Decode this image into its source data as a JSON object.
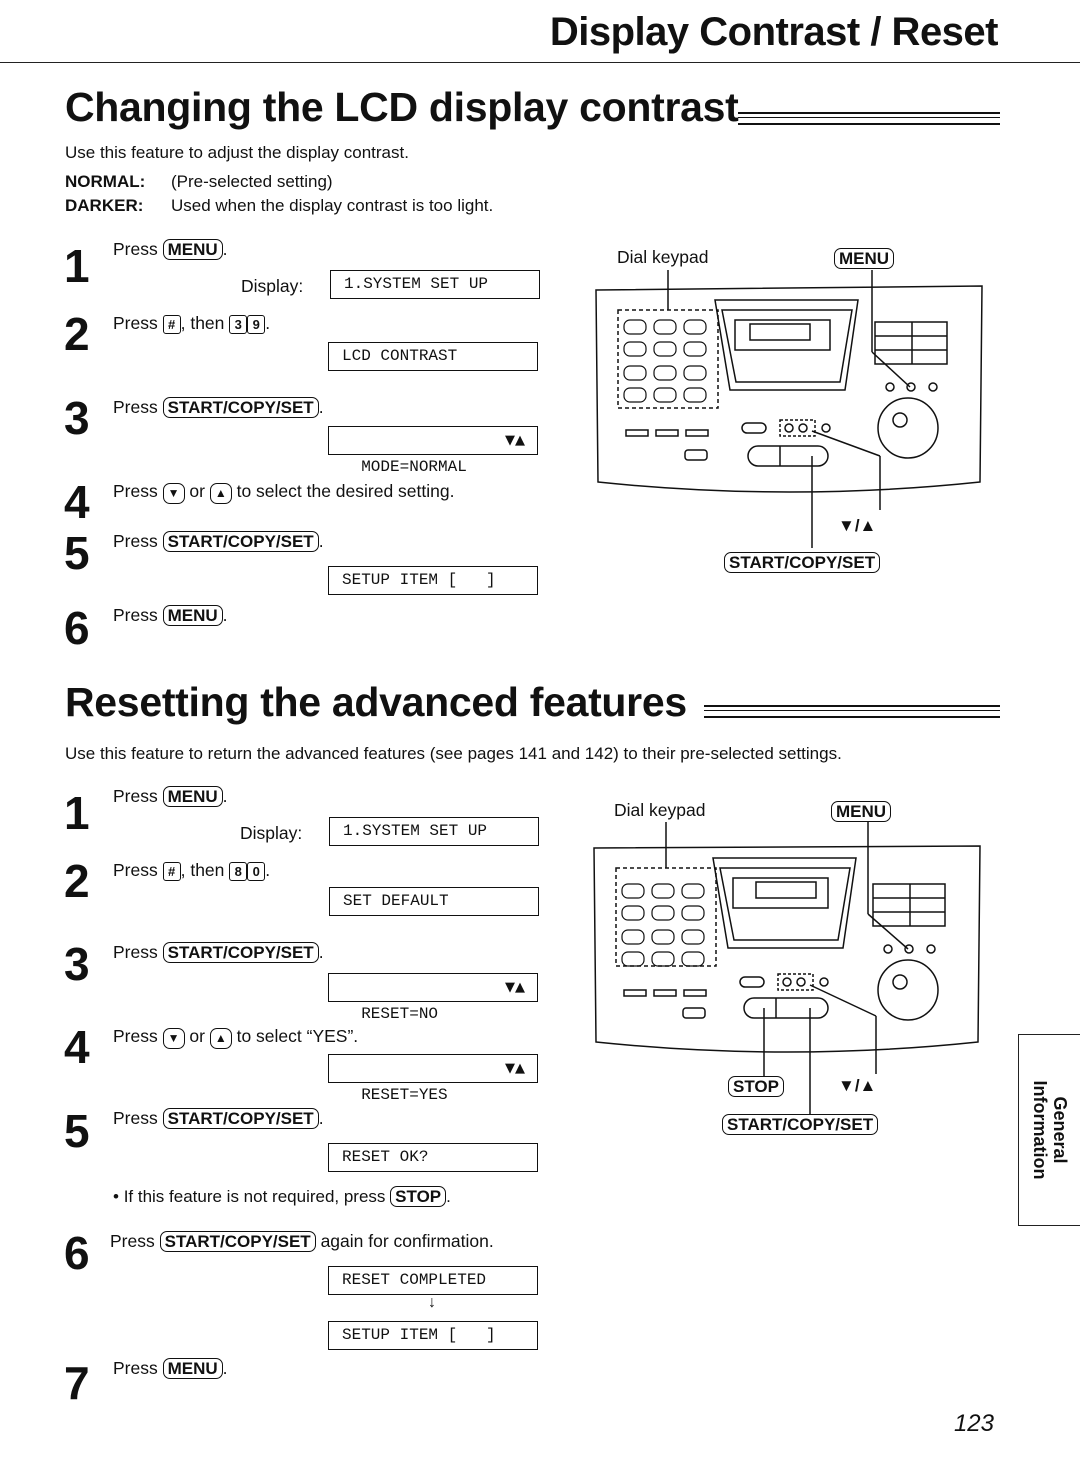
{
  "header": {
    "title": "Display Contrast / Reset"
  },
  "section1": {
    "title": "Changing the LCD display contrast",
    "intro": "Use this feature to adjust the display contrast.",
    "options": [
      {
        "label": "NORMAL:",
        "text": "(Pre-selected setting)"
      },
      {
        "label": "DARKER:",
        "text": "Used when the display contrast is too light."
      }
    ],
    "steps": [
      {
        "num": "1",
        "pre": "Press",
        "key": "MENU",
        "post": "."
      },
      {
        "num": "2",
        "pre": "Press",
        "key_hash": "#",
        "mid": ", then",
        "digits": [
          "3",
          "9"
        ],
        "post": "."
      },
      {
        "num": "3",
        "pre": "Press",
        "key": "START/COPY/SET",
        "post": "."
      },
      {
        "num": "4",
        "pre": "Press",
        "down": "▼",
        "or": "or",
        "up": "▲",
        "post": "to select the desired setting."
      },
      {
        "num": "5",
        "pre": "Press",
        "key": "START/COPY/SET",
        "post": "."
      },
      {
        "num": "6",
        "pre": "Press",
        "key": "MENU",
        "post": "."
      }
    ],
    "display_label": "Display:",
    "lcd": [
      "1.SYSTEM SET UP",
      "LCD CONTRAST",
      "MODE=NORMAL",
      "SETUP ITEM [   ]"
    ],
    "lcd_arrows": "▼▲",
    "diagram": {
      "dial_keypad": "Dial keypad",
      "menu": "MENU",
      "arrows": "▼/▲",
      "start": "START/COPY/SET"
    }
  },
  "section2": {
    "title": "Resetting the advanced features",
    "intro": "Use this feature to return the advanced features (see pages 141 and 142) to their pre-selected settings.",
    "steps": [
      {
        "num": "1",
        "pre": "Press",
        "key": "MENU",
        "post": "."
      },
      {
        "num": "2",
        "pre": "Press",
        "key_hash": "#",
        "mid": ", then",
        "digits": [
          "8",
          "0"
        ],
        "post": "."
      },
      {
        "num": "3",
        "pre": "Press",
        "key": "START/COPY/SET",
        "post": "."
      },
      {
        "num": "4",
        "pre": "Press",
        "down": "▼",
        "or": "or",
        "up": "▲",
        "post": "to select “YES”."
      },
      {
        "num": "5",
        "pre": "Press",
        "key": "START/COPY/SET",
        "post": "."
      },
      {
        "num": "6",
        "pre": "Press",
        "key": "START/COPY/SET",
        "post": "again for confirmation."
      },
      {
        "num": "7",
        "pre": "Press",
        "key": "MENU",
        "post": "."
      }
    ],
    "bullet": {
      "text": "If this feature is not required, press",
      "key": "STOP",
      "post": "."
    },
    "display_label": "Display:",
    "lcd": [
      "1.SYSTEM SET UP",
      "SET DEFAULT",
      "RESET=NO",
      "RESET=YES",
      "RESET OK?",
      "RESET COMPLETED",
      "SETUP ITEM [   ]"
    ],
    "lcd_arrows": "▼▲",
    "flow_arrow": "↓",
    "diagram": {
      "dial_keypad": "Dial keypad",
      "menu": "MENU",
      "stop": "STOP",
      "arrows": "▼/▲",
      "start": "START/COPY/SET"
    }
  },
  "side_tab": {
    "line1": "General",
    "line2": "Information"
  },
  "page_number": "123"
}
